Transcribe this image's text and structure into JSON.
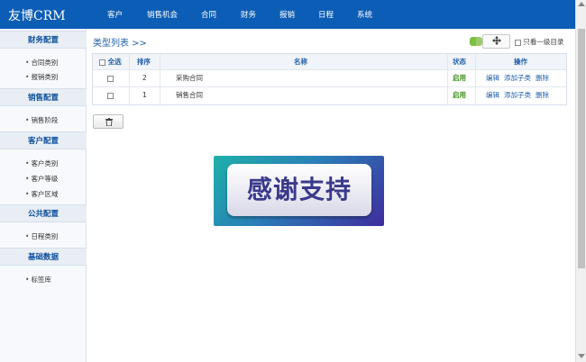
{
  "app": {
    "logo": "友博CRM"
  },
  "nav": [
    {
      "label": "客户"
    },
    {
      "label": "销售机会"
    },
    {
      "label": "合同"
    },
    {
      "label": "财务"
    },
    {
      "label": "报销"
    },
    {
      "label": "日程"
    },
    {
      "label": "系统"
    }
  ],
  "sidebar": {
    "sections": [
      {
        "title": "财务配置",
        "items": [
          "合同类别",
          "报销类别"
        ]
      },
      {
        "title": "销售配置",
        "items": [
          "销售阶段"
        ]
      },
      {
        "title": "客户配置",
        "items": [
          "客户类别",
          "客户等级",
          "客户区域"
        ]
      },
      {
        "title": "公共配置",
        "items": [
          "日程类别"
        ]
      },
      {
        "title": "基础数据",
        "items": [
          "标签库"
        ]
      }
    ]
  },
  "main": {
    "title": "类型列表 >>",
    "sort_icon": "move-arrows-icon",
    "only_root_label": "只看一级目录",
    "table": {
      "headers": {
        "select_all": "全选",
        "sort": "排序",
        "name": "名称",
        "status": "状态",
        "actions": "操作"
      },
      "rows": [
        {
          "sort": "2",
          "name": "采购合同",
          "status": "启用",
          "actions": [
            "编辑",
            "添加子类",
            "删除"
          ]
        },
        {
          "sort": "1",
          "name": "销售合同",
          "status": "启用",
          "actions": [
            "编辑",
            "添加子类",
            "删除"
          ]
        }
      ]
    },
    "delete_button_icon": "trash-icon",
    "banner_text": "感谢支持"
  },
  "colors": {
    "topbar": "#0c5db5",
    "accent": "#1f5fa8",
    "status_on": "#3a8f17"
  }
}
